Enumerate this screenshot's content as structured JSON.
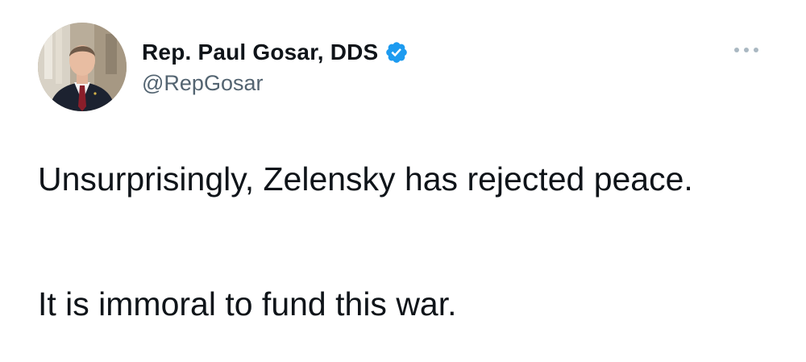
{
  "author": {
    "display_name": "Rep. Paul Gosar, DDS",
    "handle": "@RepGosar",
    "verified": true,
    "avatar_icon": "profile-photo",
    "verified_icon": "verified-badge-icon",
    "more_icon": "more-options-icon"
  },
  "tweet": {
    "paragraphs": [
      "Unsurprisingly, Zelensky has rejected peace.",
      "It is immoral to fund this war."
    ]
  },
  "colors": {
    "text_primary": "#0f1419",
    "text_secondary": "#536471",
    "verified_blue": "#1d9bf0",
    "background": "#ffffff"
  }
}
